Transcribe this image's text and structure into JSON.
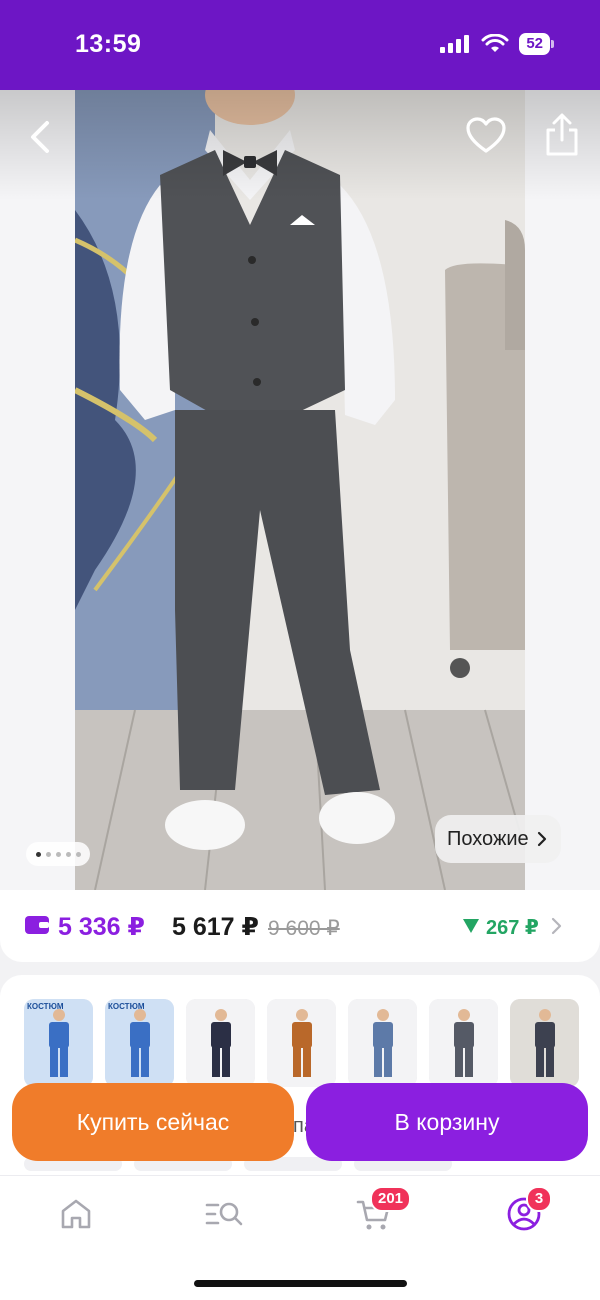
{
  "status_bar": {
    "time": "13:59",
    "battery": "52",
    "icons": [
      "signal-icon",
      "wifi-icon",
      "battery-icon"
    ]
  },
  "gallery": {
    "photo_alt": "Boy in grey vest and trousers suit",
    "similar_label": "Похожие",
    "page_indicator_count": 5,
    "page_indicator_active": 1
  },
  "price": {
    "wallet_price": "5 336 ₽",
    "price": "5 617 ₽",
    "old_price": "9 600 ₽",
    "price_drop": "267 ₽"
  },
  "variants": {
    "thumbnails": [
      {
        "label": "КОСТЮМ",
        "accent": "#3a6fc4"
      },
      {
        "label": "КОСТЮМ",
        "accent": "#3a6fc4"
      },
      {
        "label": "",
        "accent": "#2b2f45"
      },
      {
        "label": "",
        "accent": "#b9682a"
      },
      {
        "label": "",
        "accent": "#5d7aa8"
      },
      {
        "label": "",
        "accent": "#555a66"
      },
      {
        "label": "",
        "accent": "#3d4150"
      }
    ],
    "partial_text": "па"
  },
  "actions": {
    "buy_now": "Купить сейчас",
    "add_to_cart": "В корзину"
  },
  "tabbar": {
    "cart_badge": "201",
    "profile_badge": "3"
  },
  "colors": {
    "brand": "#6d16c5",
    "accent_purple": "#8b1fe0",
    "buy_orange": "#f07c2a",
    "drop_green": "#23a563",
    "badge_red": "#f0325a"
  }
}
